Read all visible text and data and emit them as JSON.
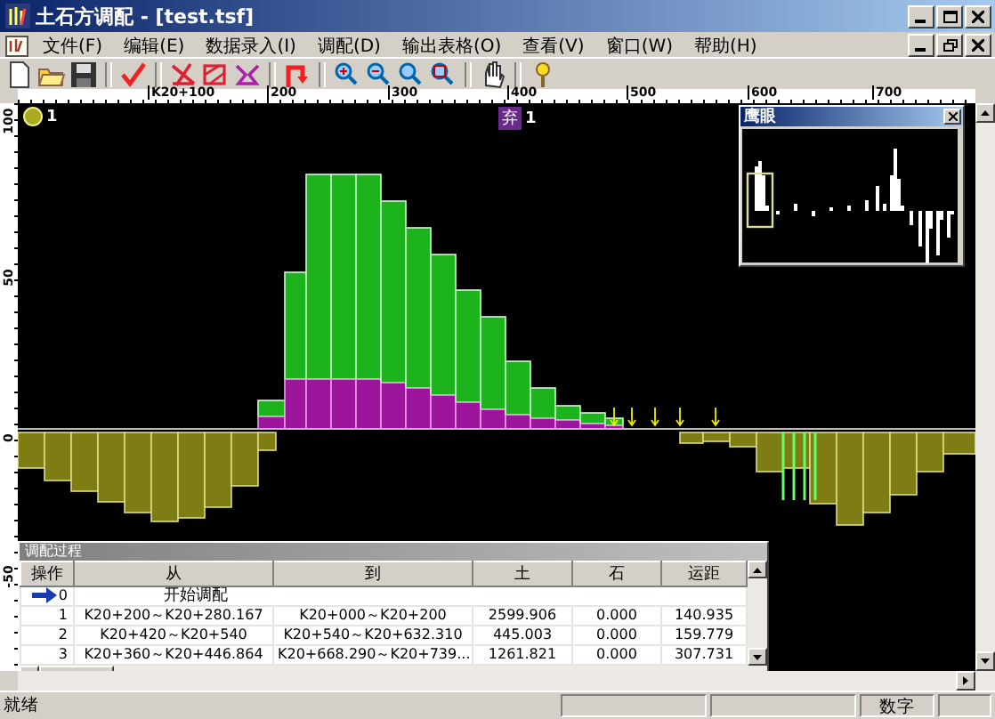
{
  "window": {
    "title": "土石方调配 - [test.tsf]"
  },
  "menu": [
    "文件(F)",
    "编辑(E)",
    "数据录入(I)",
    "调配(D)",
    "输出表格(O)",
    "查看(V)",
    "窗口(W)",
    "帮助(H)"
  ],
  "ruler": {
    "x_labels": [
      "K20+100",
      "200",
      "300",
      "400",
      "500",
      "600",
      "700"
    ],
    "y_labels": [
      "100",
      "50",
      "0",
      "-50"
    ]
  },
  "markers": [
    {
      "kind": "fill",
      "label": "1"
    },
    {
      "kind": "waste",
      "tag": "弃",
      "label": "1"
    }
  ],
  "overview": {
    "title": "鹰眼"
  },
  "dialog": {
    "title": "调配过程",
    "columns": [
      "操作",
      "从",
      "到",
      "土",
      "石",
      "运距"
    ],
    "rows": [
      {
        "kind": "start",
        "op": "0",
        "current": true,
        "text": "开始调配"
      },
      {
        "kind": "transfer",
        "op": "1",
        "current": false,
        "from": "K20+200～K20+280.167",
        "to": "K20+000～K20+200",
        "soil": "2599.906",
        "rock": "0.000",
        "distance": "140.935"
      },
      {
        "kind": "transfer",
        "op": "2",
        "current": false,
        "from": "K20+420～K20+540",
        "to": "K20+540～K20+632.310",
        "soil": "445.003",
        "rock": "0.000",
        "distance": "159.779"
      },
      {
        "kind": "transfer",
        "op": "3",
        "current": false,
        "from": "K20+360～K20+446.864",
        "to": "K20+668.290～K20+739...",
        "soil": "1261.821",
        "rock": "0.000",
        "distance": "307.731"
      }
    ]
  },
  "status_bar": {
    "text": "就绪",
    "indicator": "数字"
  }
}
